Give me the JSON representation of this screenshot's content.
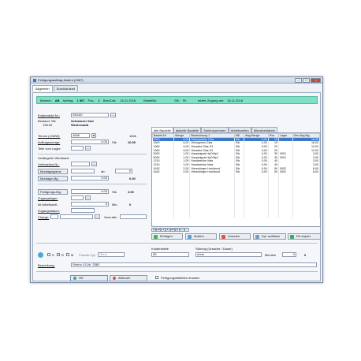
{
  "window": {
    "title": "Fertigungsauftrag ändern (1567)"
  },
  "tabs": [
    {
      "label": "Allgemein"
    },
    {
      "label": "Durchlaufzeit"
    }
  ],
  "header": {
    "bereich_label": "Bereich:",
    "bereich_value": "AB",
    "auftrag_label": "Auftrag:",
    "auftrag_value": "1 567",
    "pos_label": "Pos.:",
    "pos_value": "1",
    "bestdat_label": "Best.Dat.:",
    "bestdat_value": "16.11.2018",
    "bestellnr_label": "BestellNr.",
    "sb_label": "SB:",
    "sb_value": "FK",
    "letzter_label": "letzter Zugang am:",
    "letzter_value": "16.11.2018"
  },
  "left": {
    "endprodukt_label": "Endprodukt-Nr.:",
    "endprodukt_value": "SG100",
    "bestand_label": "Bestand: Stk",
    "bestand_value": "198.00",
    "product_name1": "Schwarzer Sud",
    "product_name2": "Westerwald",
    "termin_label": "Termin (JJWW):",
    "termin_value": "1846",
    "termin_right": "1846",
    "auftragsmenge_label": "Auftragsmenge:",
    "auftragsmenge_value": "0.00",
    "auftragsmenge_unit": "Stk",
    "auftragsmenge_right": "10.00",
    "teile_label": "Teile vom Lager:",
    "werkbank_label": "Verlängerte Werkbank",
    "lieferanten_label": "Lieferanten-Nr.:",
    "montagegrams_label": "Montagegrams",
    "ab_label": "ab:",
    "montagegrams_value": "0",
    "montagemg_label": "Montage-Mg.",
    "montagemg_value": "0.00",
    "montagemg_right": "0.00",
    "fertigungsmg_label": "Fertigungs-Mg.",
    "fertigungsmg_value": "0.00",
    "fertigungsmg_unit": "Stk",
    "fertigungsmg_right": "3.00",
    "zugangslager_label": "Zugangslager:",
    "istarbeitszeit_label": "Ist Arbeitszeit:",
    "istarbeitszeit_value": "0",
    "istarbeitszeit_unit": "Min.",
    "istarbeitszeit_right": "0",
    "zugangsdatum_label": "Zugangsdatum:",
    "charge_label": "Charge:",
    "verwdtm_label": "Verw.dtm"
  },
  "grid": {
    "tabs": [
      "alle Bauteile",
      "aktuelle Bauteile",
      "Seriennummern",
      "Arbeitszeiten",
      "Minusbestände"
    ],
    "columns": [
      "Bauteil-Nr",
      "Menge",
      "Bezeichnung 1",
      "ME",
      "Abg.Menge",
      "Pos",
      "Lager",
      "Ges.Abg.Mg."
    ],
    "rows": [
      {
        "nr": "1520",
        "menge": "6,00",
        "bez": "Gebrauchtes Glas",
        "me": "Stk",
        "abg": "0,00",
        "pos": "10",
        "lager": "",
        "ges": "18,00",
        "selected": true
      },
      {
        "nr": "1500",
        "menge": "6,00",
        "bez": "Gebogenes Glas",
        "me": "Stk",
        "abg": "0,00",
        "pos": "10",
        "lager": "",
        "ges": "18,00",
        "selected": false
      },
      {
        "nr": "1060",
        "menge": "4,00",
        "bez": "Gerades Glas 2/1",
        "me": "Stk",
        "abg": "0,00",
        "pos": "20",
        "lager": "",
        "ges": "12,00",
        "selected": false
      },
      {
        "nr": "1060",
        "menge": "4,00",
        "bez": "Gerades Glas 2/1",
        "me": "Stk",
        "abg": "0,00",
        "pos": "20",
        "lager": "",
        "ges": "12,00",
        "selected": false
      },
      {
        "nr": "5092",
        "menge": "1,00",
        "bez": "Hauptsignal HpO/Hp1",
        "me": "Stk",
        "abg": "0,00",
        "pos": "30",
        "lager": "0001",
        "ges": "3,00",
        "selected": false
      },
      {
        "nr": "5092",
        "menge": "1,00",
        "bez": "Hauptsignal HpO/Hp1",
        "me": "Stk",
        "abg": "0,00",
        "pos": "30",
        "lager": "0001",
        "ges": "3,00",
        "selected": false
      },
      {
        "nr": "1210",
        "menge": "1,00",
        "bez": "Handweiche links",
        "me": "Stk",
        "abg": "0,00",
        "pos": "40",
        "lager": "",
        "ges": "3,00",
        "selected": false
      },
      {
        "nr": "1210",
        "menge": "1,00",
        "bez": "Handweiche links",
        "me": "Stk",
        "abg": "0,00",
        "pos": "40",
        "lager": "",
        "ges": "3,00",
        "selected": false
      },
      {
        "nr": "4162",
        "menge": "2,00",
        "bez": "Vierschieger Hochbord",
        "me": "Stk",
        "abg": "0,00",
        "pos": "50",
        "lager": "0002",
        "ges": "6,00",
        "selected": false
      },
      {
        "nr": "4162",
        "menge": "2,00",
        "bez": "Vierschieger Hochbord",
        "me": "Stk",
        "abg": "0,00",
        "pos": "50",
        "lager": "0002",
        "ges": "6,00",
        "selected": false
      }
    ],
    "buttons": {
      "einfuegen": "Einfügen",
      "aendern": "Ändern",
      "loeschen": "Löschen",
      "aufloesen": "Kpl. auflösen",
      "reimport": "Re-Import"
    }
  },
  "bottom": {
    "srm_s": "S",
    "srm_r": "R",
    "srm_m": "M",
    "pawork_label": "Pawork-Typ",
    "pawork_value": "Ohne",
    "kostenstelle_label": "Kostenstelle",
    "kostenstelle_value": "95",
    "stoerung_label": "Störung (Ursache / Dauer)",
    "stoerung_value": "ohne",
    "minuten_label": "Minuten",
    "minuten_value": "0",
    "minuten_right": "0",
    "bemerkung_label": "Bemerkung:",
    "bemerkung_value": "Storno LS-Nr. 3363"
  },
  "footer": {
    "ok": "OK",
    "abbruch": "Abbruch",
    "drucken": "Fertigungsetiketten drucken"
  }
}
